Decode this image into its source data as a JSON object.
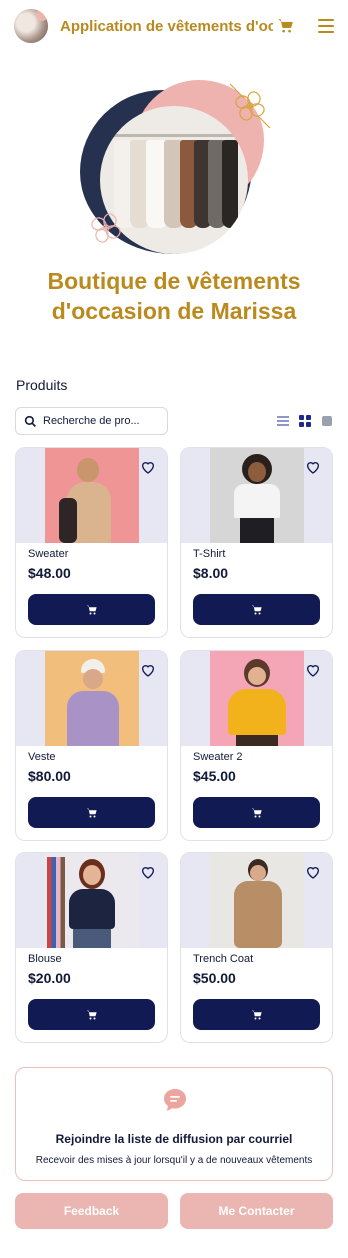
{
  "header": {
    "app_title": "Application de vêtements d'oc...",
    "icons": [
      "avatar",
      "cart-icon",
      "menu-icon"
    ]
  },
  "store": {
    "title_line1": "Boutique de vêtements",
    "title_line2": "d'occasion de Marissa"
  },
  "products_section": {
    "label": "Produits",
    "search_placeholder": "Recherche de pro...",
    "view_icons": [
      "list-view-icon",
      "grid-view-icon",
      "single-view-icon"
    ]
  },
  "products": [
    {
      "name": "Sweater",
      "price": "$48.00"
    },
    {
      "name": "T-Shirt",
      "price": "$8.00"
    },
    {
      "name": "Veste",
      "price": "$80.00"
    },
    {
      "name": "Sweater 2",
      "price": "$45.00"
    },
    {
      "name": "Blouse",
      "price": "$20.00"
    },
    {
      "name": "Trench Coat",
      "price": "$50.00"
    }
  ],
  "newsletter": {
    "title": "Rejoindre la liste de diffusion par courriel",
    "subtitle": "Recevoir des mises à jour lorsqu'il y a de nouveaux vêtements"
  },
  "footer_buttons": {
    "feedback": "Feedback",
    "contact": "Me Contacter"
  },
  "colors": {
    "accent_gold": "#b98a1e",
    "navy": "#111a52",
    "pink": "#ebb6b1",
    "image_bg": "#e6e7f3"
  }
}
